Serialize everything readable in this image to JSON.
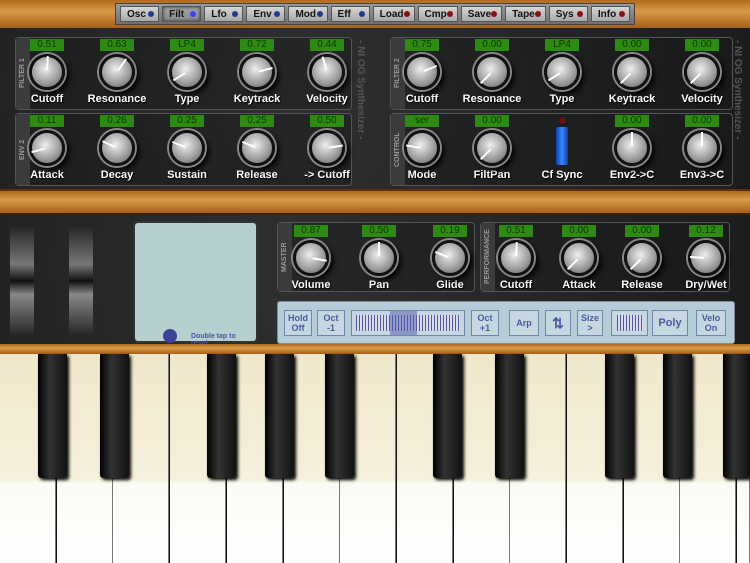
{
  "menu": [
    {
      "label": "Osc",
      "led": "#223a8a"
    },
    {
      "label": "Filt",
      "led": "#3344ff",
      "active": true
    },
    {
      "label": "Lfo",
      "led": "#223a8a"
    },
    {
      "label": "Env",
      "led": "#223a8a"
    },
    {
      "label": "Mod",
      "led": "#223a8a"
    },
    {
      "label": "Eff",
      "led": "#223a8a"
    },
    {
      "label": "Load",
      "led": "#8a1010"
    },
    {
      "label": "Cmp",
      "led": "#8a1010"
    },
    {
      "label": "Save",
      "led": "#8a1010"
    },
    {
      "label": "Tape",
      "led": "#8a1010"
    },
    {
      "label": "Sys",
      "led": "#8a1010"
    },
    {
      "label": "Info",
      "led": "#8a1010"
    }
  ],
  "brand": "- NI OG Synthesizer -",
  "sections": [
    {
      "title": "FILTER 1",
      "knobs": [
        {
          "label": "Cutoff",
          "value": "0.51",
          "level": 0.51
        },
        {
          "label": "Resonance",
          "value": "0.63",
          "level": 0.63
        },
        {
          "label": "Type",
          "value": "LP4",
          "level": 0.05
        },
        {
          "label": "Keytrack",
          "value": "0.72",
          "level": 0.78
        },
        {
          "label": "Velocity",
          "value": "0.44",
          "level": 0.44
        }
      ]
    },
    {
      "title": "ENV 2",
      "knobs": [
        {
          "label": "Attack",
          "value": "0.11",
          "level": 0.11
        },
        {
          "label": "Decay",
          "value": "0.26",
          "level": 0.26
        },
        {
          "label": "Sustain",
          "value": "0.25",
          "level": 0.25
        },
        {
          "label": "Release",
          "value": "0.25",
          "level": 0.25
        },
        {
          "label": "-> Cutoff",
          "value": "0.50",
          "level": 0.8
        }
      ]
    },
    {
      "title": "FILTER 2",
      "knobs": [
        {
          "label": "Cutoff",
          "value": "0.75",
          "level": 0.75
        },
        {
          "label": "Resonance",
          "value": "0.00",
          "level": 0
        },
        {
          "label": "Type",
          "value": "LP4",
          "level": 0.05
        },
        {
          "label": "Keytrack",
          "value": "0.00",
          "level": 0
        },
        {
          "label": "Velocity",
          "value": "0.00",
          "level": 0
        }
      ]
    },
    {
      "title": "CONTROL",
      "knobs": [
        {
          "label": "Mode",
          "value": "ser",
          "level": 0.2
        },
        {
          "label": "FiltPan",
          "value": "0.00",
          "level": 0
        },
        {
          "label": "Cf Sync",
          "switch": true
        },
        {
          "label": "Env2->C",
          "value": "0.00",
          "level": 0.5
        },
        {
          "label": "Env3->C",
          "value": "0.00",
          "level": 0.5
        }
      ]
    },
    {
      "title": "MASTER",
      "knobs": [
        {
          "label": "Volume",
          "value": "0.87",
          "level": 0.87
        },
        {
          "label": "Pan",
          "value": "0.50",
          "level": 0.5
        },
        {
          "label": "Glide",
          "value": "0.19",
          "level": 0.25
        }
      ]
    },
    {
      "title": "PERFORMANCE",
      "knobs": [
        {
          "label": "Cutoff",
          "value": "0.51",
          "level": 0.51
        },
        {
          "label": "Attack",
          "value": "0.00",
          "level": 0
        },
        {
          "label": "Release",
          "value": "0.00",
          "level": 0
        },
        {
          "label": "Dry/Wet",
          "value": "0.12",
          "level": 0.18
        }
      ]
    }
  ],
  "pad": {
    "hint": "Double tap to reset."
  },
  "buttons": [
    "Hold\nOff",
    "Oct\n-1",
    "Oct\n+1",
    "Arp",
    "Size\n>",
    "Poly",
    "Velo\nOn"
  ]
}
